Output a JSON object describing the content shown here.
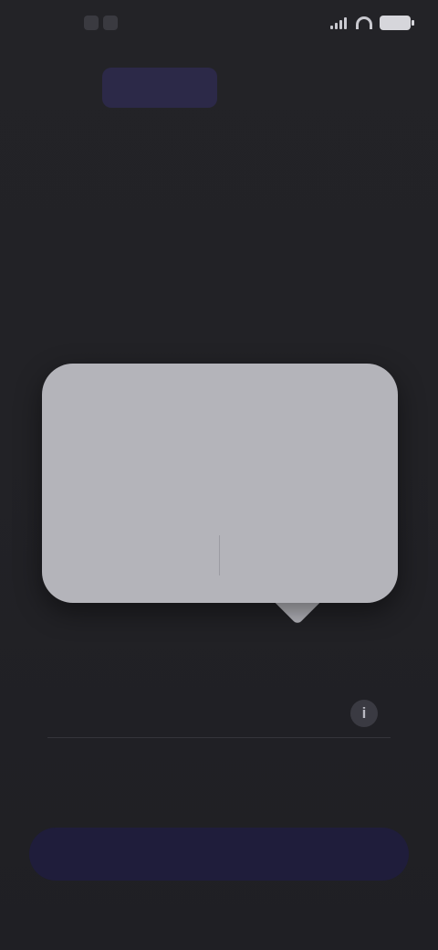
{
  "status_bar": {
    "time": "",
    "battery": ""
  },
  "header": {
    "logo_text": "",
    "title": ""
  },
  "form": {
    "field_label": "",
    "info_icon": "i"
  },
  "tooltip": {
    "title": "",
    "body": "",
    "secondary_button": "",
    "primary_button": ""
  },
  "footer": {
    "primary_button": ""
  },
  "colors": {
    "background": "#222225",
    "accent": "#a9a2ff",
    "button_bg": "#1f1d3b",
    "tooltip_bg": "#b4b4ba"
  },
  "icons": {
    "signal": "signal-icon",
    "wifi": "wifi-icon",
    "battery": "battery-icon",
    "info": "info-icon"
  }
}
